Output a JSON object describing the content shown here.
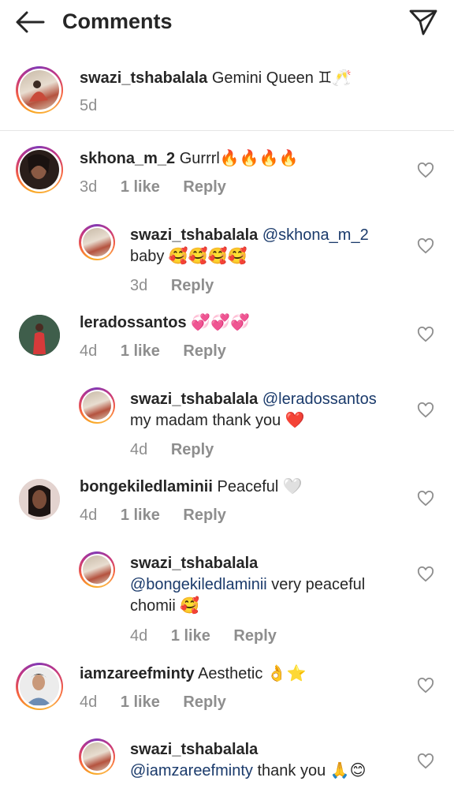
{
  "header": {
    "title": "Comments"
  },
  "caption": {
    "username": "swazi_tshabalala",
    "text": "Gemini Queen ♊🥂",
    "time": "5d"
  },
  "comments": [
    {
      "username": "skhona_m_2",
      "text": "Gurrrl🔥🔥🔥🔥",
      "time": "3d",
      "likes": "1 like",
      "reply": "Reply"
    },
    {
      "username": "swazi_tshabalala",
      "mention": "@skhona_m_2",
      "text": "baby 🥰🥰🥰🥰",
      "time": "3d",
      "reply": "Reply"
    },
    {
      "username": "leradossantos",
      "text": "💞💞💞",
      "time": "4d",
      "likes": "1 like",
      "reply": "Reply"
    },
    {
      "username": "swazi_tshabalala",
      "mention": "@leradossantos",
      "text": "my madam thank you ❤️",
      "time": "4d",
      "reply": "Reply"
    },
    {
      "username": "bongekiledlaminii",
      "text": "Peaceful 🤍",
      "time": "4d",
      "likes": "1 like",
      "reply": "Reply"
    },
    {
      "username": "swazi_tshabalala",
      "mention": "@bongekiledlaminii",
      "text": "very peaceful chomii 🥰",
      "time": "4d",
      "likes": "1 like",
      "reply": "Reply"
    },
    {
      "username": "iamzareefminty",
      "text": "Aesthetic 👌⭐",
      "time": "4d",
      "likes": "1 like",
      "reply": "Reply"
    },
    {
      "username": "swazi_tshabalala",
      "mention": "@iamzareefminty",
      "text": "thank you 🙏😊",
      "time": "",
      "reply": ""
    }
  ],
  "icons": {
    "back": "back-arrow-icon",
    "send": "paper-plane-icon",
    "like": "heart-outline-icon"
  },
  "colors": {
    "mention": "#1a3a6b",
    "meta": "#8e8e8e",
    "story_ring": "#c13584"
  }
}
